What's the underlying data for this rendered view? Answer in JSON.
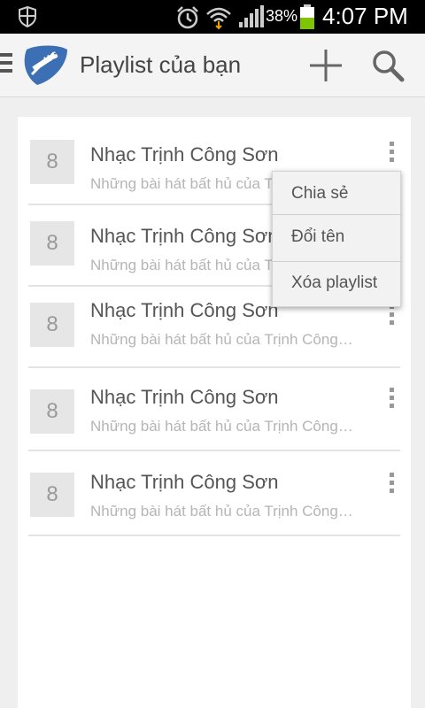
{
  "status_bar": {
    "battery_percent": "38%",
    "time": "4:07 PM",
    "icons": [
      "shield-icon",
      "alarm-icon",
      "wifi-icon",
      "signal-icon",
      "battery-icon"
    ],
    "battery_color": "#7ec400"
  },
  "action_bar": {
    "title": "Playlist của bạn",
    "logo_icon": "guitar-pick-logo",
    "actions": [
      "add-icon",
      "search-icon"
    ]
  },
  "playlists": [
    {
      "count": "8",
      "title": "Nhạc Trịnh Công Sơn",
      "subtitle": "Những bài hát bất hủ của Trịnh Công Sơn"
    },
    {
      "count": "8",
      "title": "Nhạc Trịnh Công Sơn",
      "subtitle": "Những bài hát bất hủ của Trịnh Công Sơn"
    },
    {
      "count": "8",
      "title": "Nhạc Trịnh Công Sơn",
      "subtitle": "Những bài hát bất hủ của Trịnh Công Sơn"
    },
    {
      "count": "8",
      "title": "Nhạc Trịnh Công Sơn",
      "subtitle": "Những bài hát bất hủ của Trịnh Công Sơn"
    },
    {
      "count": "8",
      "title": "Nhạc Trịnh Công Sơn",
      "subtitle": "Những bài hát bất hủ của Trịnh Công Sơn"
    }
  ],
  "popup_menu": {
    "items": [
      "Chia sẻ",
      "Đổi tên",
      "Xóa playlist"
    ]
  },
  "colors": {
    "accent_logo": "#3d6fb5",
    "background": "#efefef",
    "card": "#ffffff"
  }
}
